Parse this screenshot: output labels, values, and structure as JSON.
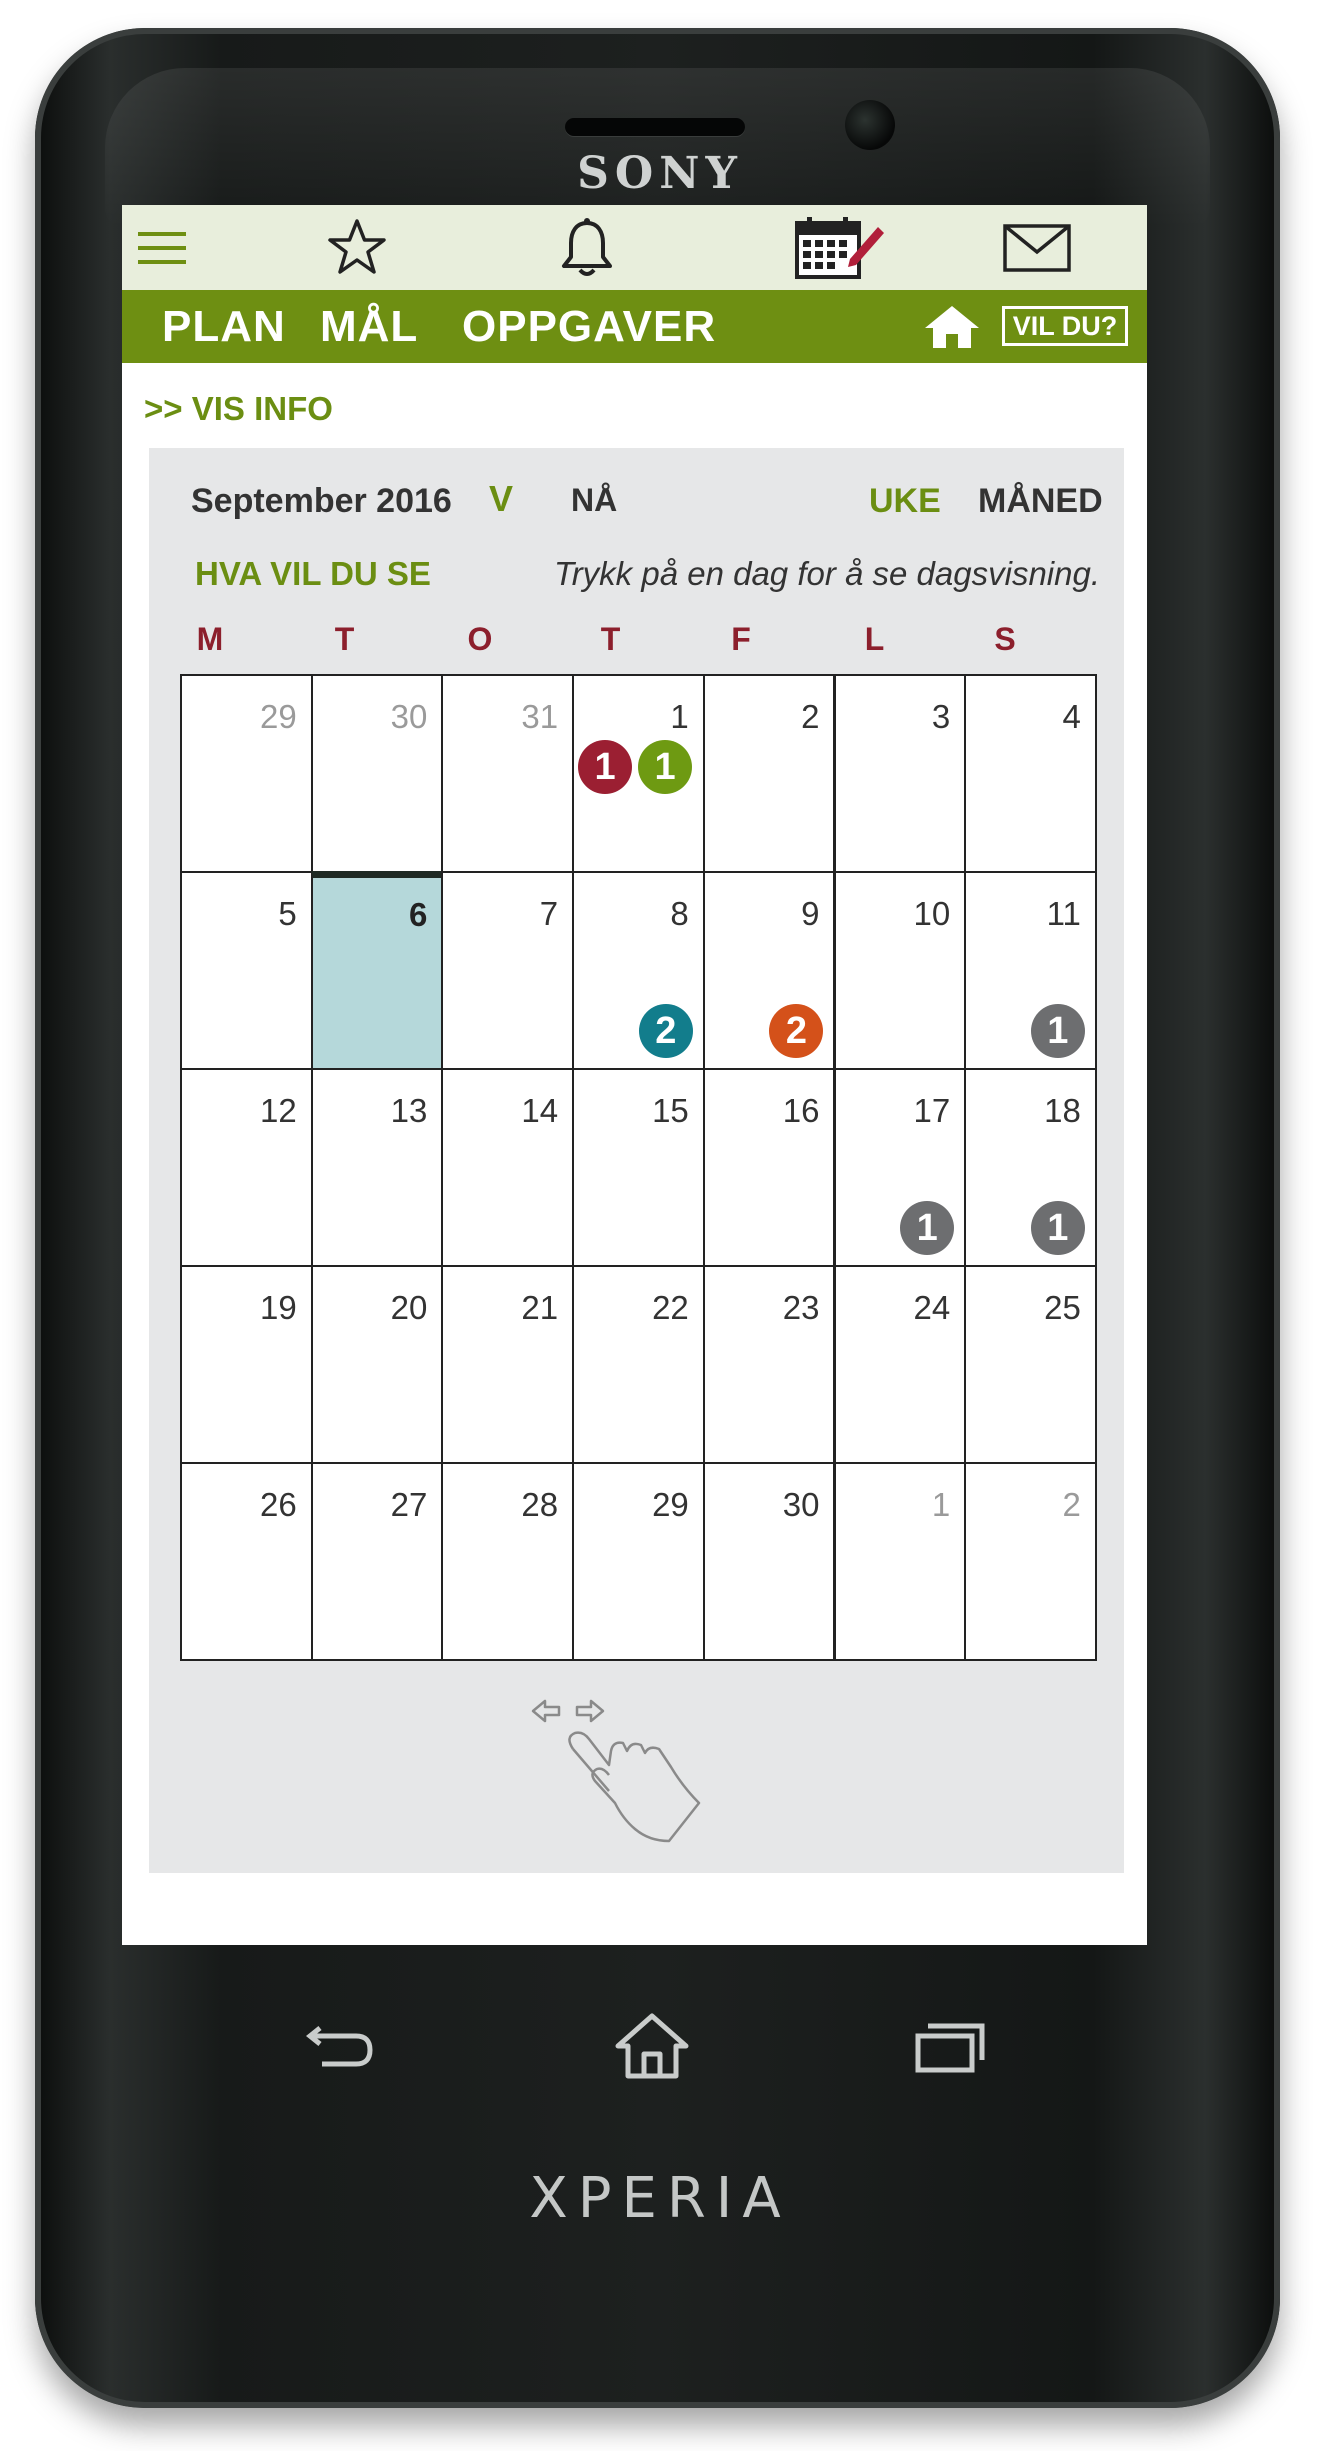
{
  "device": {
    "brand": "SONY",
    "model": "XPERIA"
  },
  "icon_bar": {
    "icons": [
      "menu-icon",
      "star-icon",
      "bell-icon",
      "calendar-edit-icon",
      "mail-icon"
    ],
    "accent": "#6e8f12",
    "bg": "#e8eedc"
  },
  "nav": {
    "plan": "PLAN",
    "maal": "MÅL",
    "oppgaver": "OPPGAVER",
    "vil_du": "VIL DU?"
  },
  "vis_info": ">> VIS INFO",
  "calendar": {
    "month_label": "September 2016",
    "dropdown": "V",
    "now_label": "NÅ",
    "week_label": "UKE",
    "month_view_label": "MÅNED",
    "what_label": "HVA VIL DU SE",
    "hint": "Trykk på en dag for å se dagsvisning.",
    "weekdays": [
      "M",
      "T",
      "O",
      "T",
      "F",
      "L",
      "S"
    ],
    "weeks": [
      [
        {
          "d": "29",
          "o": true
        },
        {
          "d": "30",
          "o": true
        },
        {
          "d": "31",
          "o": true
        },
        {
          "d": "1"
        },
        {
          "d": "2"
        },
        {
          "d": "3"
        },
        {
          "d": "4"
        }
      ],
      [
        {
          "d": "5"
        },
        {
          "d": "6",
          "today": true
        },
        {
          "d": "7"
        },
        {
          "d": "8"
        },
        {
          "d": "9"
        },
        {
          "d": "10"
        },
        {
          "d": "11"
        }
      ],
      [
        {
          "d": "12"
        },
        {
          "d": "13"
        },
        {
          "d": "14"
        },
        {
          "d": "15"
        },
        {
          "d": "16"
        },
        {
          "d": "17"
        },
        {
          "d": "18"
        }
      ],
      [
        {
          "d": "19"
        },
        {
          "d": "20"
        },
        {
          "d": "21"
        },
        {
          "d": "22"
        },
        {
          "d": "23"
        },
        {
          "d": "24"
        },
        {
          "d": "25"
        }
      ],
      [
        {
          "d": "26"
        },
        {
          "d": "27"
        },
        {
          "d": "28"
        },
        {
          "d": "29"
        },
        {
          "d": "30"
        },
        {
          "d": "1",
          "o": true
        },
        {
          "d": "2",
          "o": true
        }
      ]
    ],
    "badges": [
      {
        "week": 0,
        "day": 3,
        "count": "1",
        "color": "#9b1f32",
        "slot": "left"
      },
      {
        "week": 0,
        "day": 3,
        "count": "1",
        "color": "#6e9a12",
        "slot": "right"
      },
      {
        "week": 1,
        "day": 3,
        "count": "2",
        "color": "#127d8c",
        "slot": "bottom"
      },
      {
        "week": 1,
        "day": 4,
        "count": "2",
        "color": "#d4511a",
        "slot": "bottom"
      },
      {
        "week": 1,
        "day": 6,
        "count": "1",
        "color": "#6d6e70",
        "slot": "bottom"
      },
      {
        "week": 2,
        "day": 5,
        "count": "1",
        "color": "#6d6e70",
        "slot": "bottom"
      },
      {
        "week": 2,
        "day": 6,
        "count": "1",
        "color": "#6d6e70",
        "slot": "bottom"
      }
    ],
    "today_color": "#b5d8da"
  }
}
